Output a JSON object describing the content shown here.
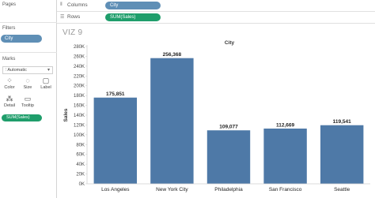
{
  "sidebar": {
    "pages_title": "Pages",
    "filters_title": "Filters",
    "filter_pill": "City",
    "marks_title": "Marks",
    "mark_type": "Automatic",
    "mark_buttons": [
      "Color",
      "Size",
      "Label",
      "Detail",
      "Tooltip"
    ],
    "mark_pill": "SUM(Sales)"
  },
  "shelves": {
    "columns_label": "Columns",
    "columns_pill": "City",
    "rows_label": "Rows",
    "rows_pill": "SUM(Sales)"
  },
  "viz_title": "VIZ 9",
  "colors": {
    "bar": "#4e79a7",
    "dimension_pill": "#5f8fb6",
    "measure_pill": "#1f9e6b"
  },
  "chart_data": {
    "type": "bar",
    "title": "",
    "xlabel": "City",
    "ylabel": "Sales",
    "categories": [
      "Los Angeles",
      "New York City",
      "Philadelphia",
      "San Francisco",
      "Seattle"
    ],
    "values": [
      175851,
      256368,
      109077,
      112669,
      119541
    ],
    "value_labels": [
      "175,851",
      "256,368",
      "109,077",
      "112,669",
      "119,541"
    ],
    "ylim": [
      0,
      280000
    ],
    "yticks": [
      0,
      20000,
      40000,
      60000,
      80000,
      100000,
      120000,
      140000,
      160000,
      180000,
      200000,
      220000,
      240000,
      260000,
      280000
    ],
    "ytick_labels": [
      "0K",
      "20K",
      "40K",
      "60K",
      "80K",
      "100K",
      "120K",
      "140K",
      "160K",
      "180K",
      "200K",
      "220K",
      "240K",
      "260K",
      "280K"
    ],
    "grid": false,
    "legend": "none"
  }
}
